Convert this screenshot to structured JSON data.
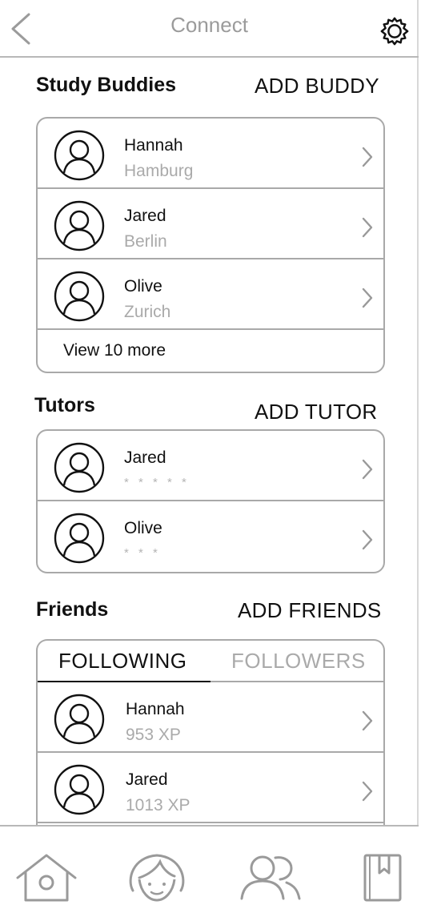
{
  "header": {
    "title": "Connect"
  },
  "study_buddies": {
    "title": "Study Buddies",
    "action": "ADD BUDDY",
    "items": [
      {
        "name": "Hannah",
        "location": "Hamburg"
      },
      {
        "name": "Jared",
        "location": "Berlin"
      },
      {
        "name": "Olive",
        "location": "Zurich"
      }
    ],
    "more_label": "View 10 more"
  },
  "tutors": {
    "title": "Tutors",
    "action": "ADD TUTOR",
    "items": [
      {
        "name": "Jared",
        "rating": "* * * * *"
      },
      {
        "name": "Olive",
        "rating": "* * *"
      }
    ]
  },
  "friends": {
    "title": "Friends",
    "action": "ADD FRIENDS",
    "tabs": [
      {
        "label": "FOLLOWING",
        "active": true
      },
      {
        "label": "FOLLOWERS",
        "active": false
      }
    ],
    "items": [
      {
        "name": "Hannah",
        "xp": "953 XP"
      },
      {
        "name": "Jared",
        "xp": "1013 XP"
      }
    ]
  },
  "bottom_nav": {
    "items": [
      {
        "icon": "home-icon"
      },
      {
        "icon": "profile-icon"
      },
      {
        "icon": "connect-icon",
        "active": true
      },
      {
        "icon": "book-icon"
      }
    ]
  },
  "colors": {
    "border": "#a9a9a9",
    "muted_text": "#aaaaaa",
    "title_gray": "#9b9b9b"
  }
}
